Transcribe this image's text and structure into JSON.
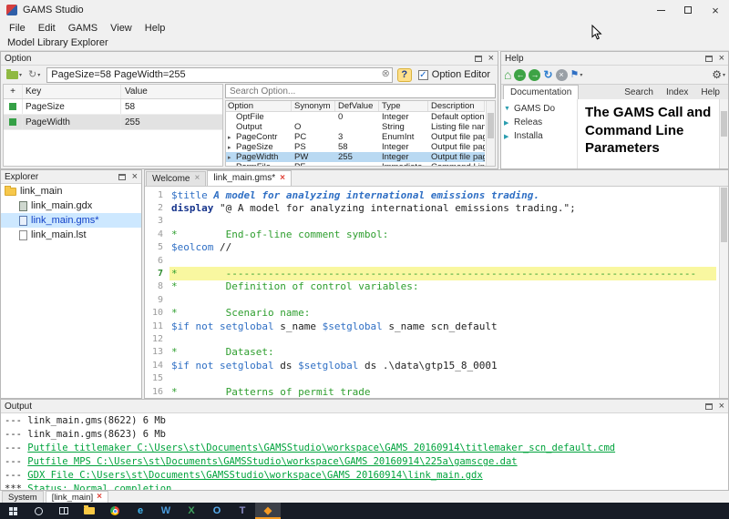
{
  "colors": {
    "selection": "#b9d9f2",
    "link_green": "#00a33c",
    "line_highlight": "#f9f7a0",
    "comment_green": "#2e9e2e",
    "directive_blue": "#2f6fc4",
    "keyword_navy": "#16348c",
    "taskbar_bg": "#171c26"
  },
  "window": {
    "title": "GAMS Studio",
    "menus": [
      "File",
      "Edit",
      "GAMS",
      "View",
      "Help"
    ],
    "model_library_label": "Model Library Explorer"
  },
  "option_panel": {
    "title": "Option",
    "command_line": "PageSize=58 PageWidth=255",
    "option_editor_label": "Option Editor",
    "option_editor_checked": true,
    "defined_options": {
      "headers": [
        "+",
        "Key",
        "Value"
      ],
      "rows": [
        {
          "key": "PageSize",
          "value": "58",
          "selected": false
        },
        {
          "key": "PageWidth",
          "value": "255",
          "selected": true
        }
      ]
    },
    "search_placeholder": "Search Option...",
    "options_table": {
      "headers": [
        "Option",
        "Synonym",
        "DefValue",
        "Type",
        "Description"
      ],
      "rows": [
        {
          "option": "OptFile",
          "synonym": "",
          "defvalue": "0",
          "type": "Integer",
          "description": "Default option file",
          "expandable": false,
          "selected": false
        },
        {
          "option": "Output",
          "synonym": "O",
          "defvalue": "",
          "type": "String",
          "description": "Listing file name",
          "expandable": false,
          "selected": false
        },
        {
          "option": "PageContr",
          "synonym": "PC",
          "defvalue": "3",
          "type": "EnumInt",
          "description": "Output file page cont...",
          "expandable": true,
          "selected": false
        },
        {
          "option": "PageSize",
          "synonym": "PS",
          "defvalue": "58",
          "type": "Integer",
          "description": "Output file page size (...",
          "expandable": true,
          "selected": false
        },
        {
          "option": "PageWidth",
          "synonym": "PW",
          "defvalue": "255",
          "type": "Integer",
          "description": "Output file page width",
          "expandable": true,
          "selected": true
        },
        {
          "option": "PermFile",
          "synonym": "PF",
          "defvalue": "",
          "type": "Immediate",
          "description": "Command Line Param...",
          "expandable": false,
          "selected": false
        }
      ]
    }
  },
  "help_panel": {
    "title": "Help",
    "tabs": [
      {
        "label": "Documentation",
        "active": true
      },
      {
        "label": "Search",
        "active": false
      },
      {
        "label": "Index",
        "active": false
      },
      {
        "label": "Help",
        "active": false
      }
    ],
    "tree": [
      {
        "label": "GAMS Do",
        "expanded": true
      },
      {
        "label": "Releas",
        "expanded": false
      },
      {
        "label": "Installa",
        "expanded": false
      }
    ],
    "content_title": "The GAMS Call and Command Line Parameters"
  },
  "explorer_panel": {
    "title": "Explorer",
    "folder_label": "link_main",
    "files": [
      {
        "label": "link_main.gdx",
        "kind": "gdx",
        "selected": false
      },
      {
        "label": "link_main.gms*",
        "kind": "gms",
        "selected": true
      },
      {
        "label": "link_main.lst",
        "kind": "lst",
        "selected": false
      }
    ]
  },
  "editor": {
    "tabs": [
      {
        "label": "Welcome",
        "active": false,
        "close_style": "plain"
      },
      {
        "label": "link_main.gms*",
        "active": true,
        "close_style": "red"
      }
    ],
    "lines": [
      {
        "n": 1,
        "hl": false,
        "seg": [
          [
            "dir",
            "$title "
          ],
          [
            "title",
            "A model for analyzing international emissions trading."
          ]
        ]
      },
      {
        "n": 2,
        "hl": false,
        "seg": [
          [
            "kw",
            "display "
          ],
          [
            "str",
            "\"@ A model for analyzing international emissions trading.\""
          ],
          [
            "plain",
            ";"
          ]
        ]
      },
      {
        "n": 3,
        "hl": false,
        "seg": []
      },
      {
        "n": 4,
        "hl": false,
        "seg": [
          [
            "com",
            "*        End-of-line comment symbol:"
          ]
        ]
      },
      {
        "n": 5,
        "hl": false,
        "seg": [
          [
            "dir",
            "$eolcom"
          ],
          [
            "plain",
            " //"
          ]
        ]
      },
      {
        "n": 6,
        "hl": false,
        "seg": []
      },
      {
        "n": 7,
        "hl": true,
        "seg": [
          [
            "com",
            "*        ------------------------------------------------------------------------------"
          ]
        ]
      },
      {
        "n": 8,
        "hl": false,
        "seg": [
          [
            "com",
            "*        Definition of control variables:"
          ]
        ]
      },
      {
        "n": 9,
        "hl": false,
        "seg": []
      },
      {
        "n": 10,
        "hl": false,
        "seg": [
          [
            "com",
            "*        Scenario name:"
          ]
        ]
      },
      {
        "n": 11,
        "hl": false,
        "seg": [
          [
            "dir",
            "$if not setglobal"
          ],
          [
            "plain",
            " s_name "
          ],
          [
            "dir",
            "$setglobal"
          ],
          [
            "plain",
            " s_name scn_default"
          ]
        ]
      },
      {
        "n": 12,
        "hl": false,
        "seg": []
      },
      {
        "n": 13,
        "hl": false,
        "seg": [
          [
            "com",
            "*        Dataset:"
          ]
        ]
      },
      {
        "n": 14,
        "hl": false,
        "seg": [
          [
            "dir",
            "$if not setglobal"
          ],
          [
            "plain",
            " ds "
          ],
          [
            "dir",
            "$setglobal"
          ],
          [
            "plain",
            " ds .\\data\\gtp15_8_0001"
          ]
        ]
      },
      {
        "n": 15,
        "hl": false,
        "seg": []
      },
      {
        "n": 16,
        "hl": false,
        "seg": [
          [
            "com",
            "*        Patterns of permit trade"
          ]
        ]
      }
    ]
  },
  "output_panel": {
    "title": "Output",
    "lines": [
      {
        "kind": "plain",
        "text": "--- link_main.gms(8622) 6 Mb"
      },
      {
        "kind": "plain",
        "text": "--- link_main.gms(8623) 6 Mb"
      },
      {
        "kind": "link",
        "prefix": "--- ",
        "text": "Putfile titlemaker C:\\Users\\st\\Documents\\GAMSStudio\\workspace\\GAMS 20160914\\titlemaker_scn_default.cmd"
      },
      {
        "kind": "link",
        "prefix": "--- ",
        "text": "Putfile MPS C:\\Users\\st\\Documents\\GAMSStudio\\workspace\\GAMS 20160914\\225a\\gamscge.dat"
      },
      {
        "kind": "link",
        "prefix": "--- ",
        "text": "GDX File C:\\Users\\st\\Documents\\GAMSStudio\\workspace\\GAMS 20160914\\link_main.gdx"
      },
      {
        "kind": "link",
        "prefix": "*** ",
        "text": "Status: Normal completion"
      }
    ]
  },
  "process_tabs": [
    {
      "label": "System",
      "active": false,
      "closable": false
    },
    {
      "label": "[link_main]",
      "active": true,
      "closable": true
    }
  ],
  "taskbar": {
    "items": [
      {
        "name": "start",
        "kind": "win"
      },
      {
        "name": "search",
        "kind": "ring"
      },
      {
        "name": "task-view",
        "kind": "panes"
      },
      {
        "name": "file-explorer",
        "kind": "folder"
      },
      {
        "name": "chrome",
        "kind": "chrome"
      },
      {
        "name": "edge",
        "kind": "letter",
        "glyph": "e",
        "color": "#3fb6f2"
      },
      {
        "name": "word",
        "kind": "letter",
        "glyph": "W",
        "color": "#4a9bdc"
      },
      {
        "name": "excel",
        "kind": "letter",
        "glyph": "X",
        "color": "#3fa35f"
      },
      {
        "name": "outlook",
        "kind": "letter",
        "glyph": "O",
        "color": "#58aef0"
      },
      {
        "name": "teams",
        "kind": "letter",
        "glyph": "T",
        "color": "#8b8cc7"
      },
      {
        "name": "gams-studio",
        "kind": "letter",
        "glyph": "◆",
        "color": "#f59a23",
        "active": true
      }
    ]
  }
}
